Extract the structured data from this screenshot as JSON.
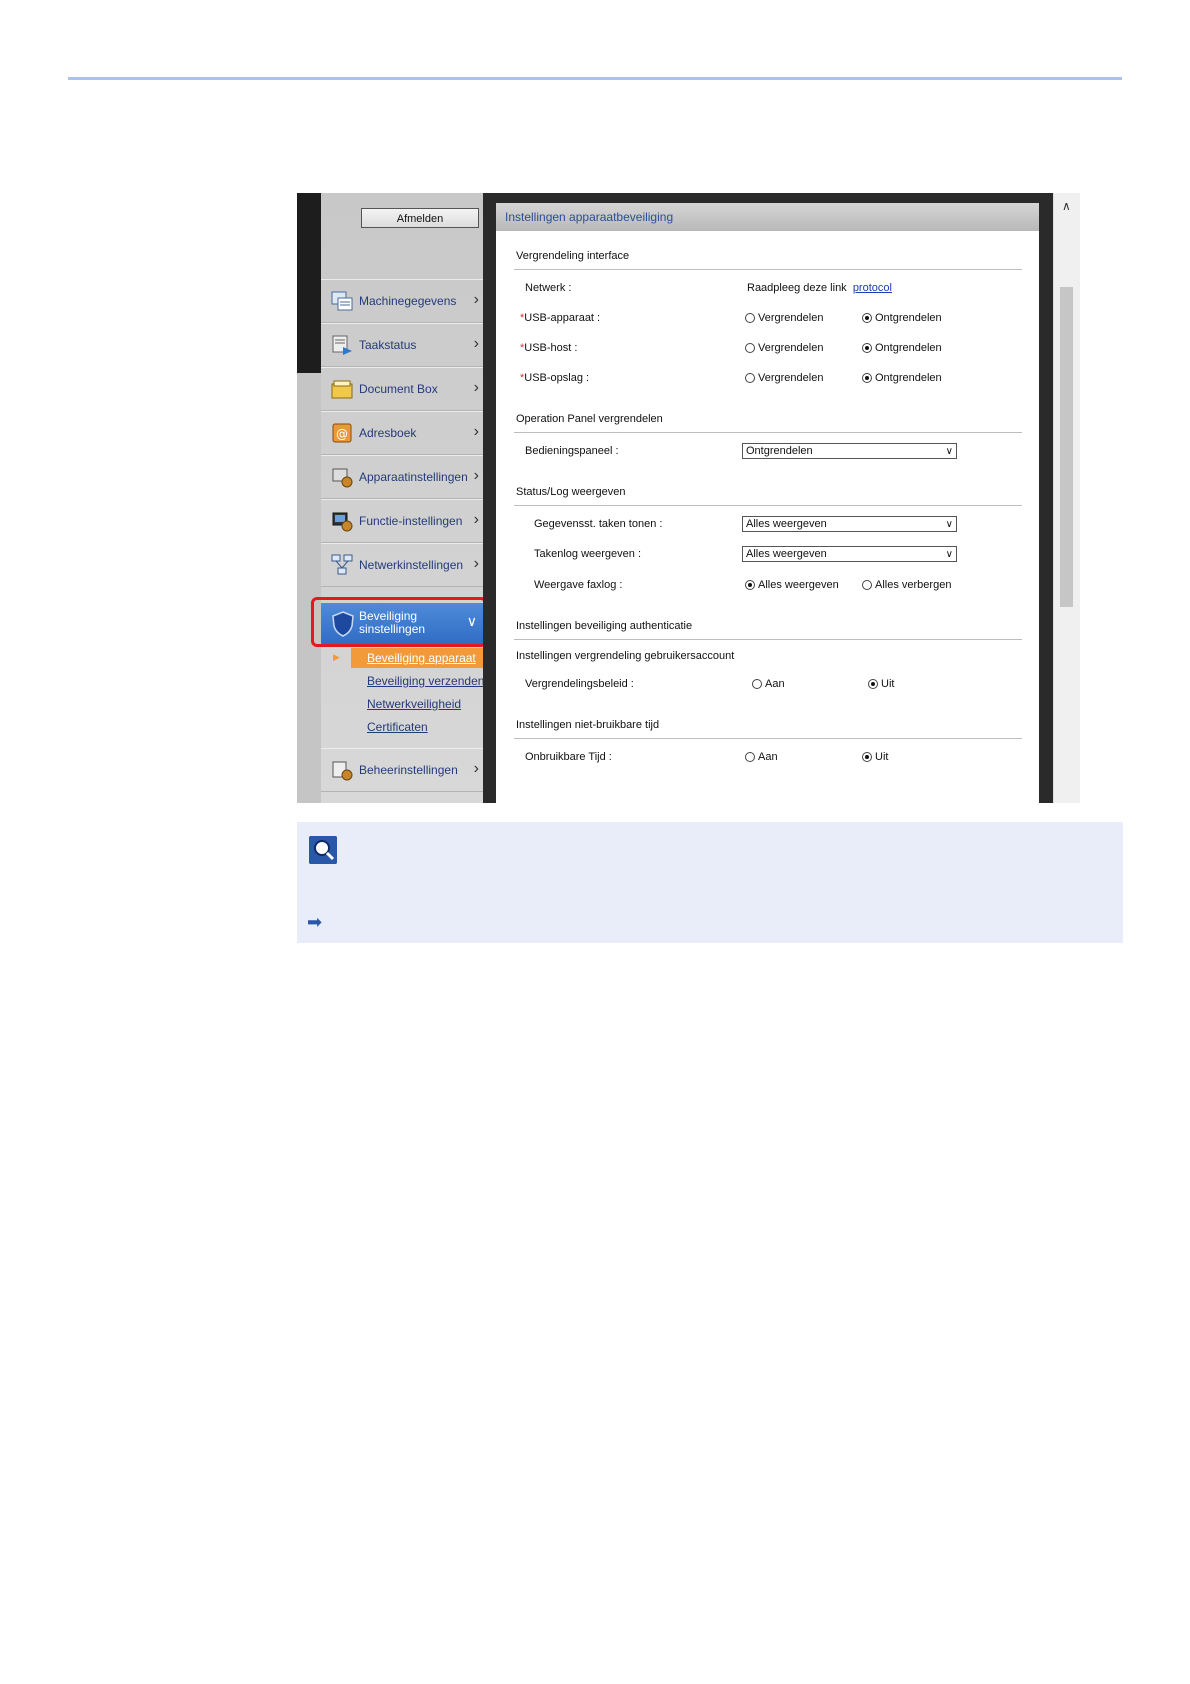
{
  "sidebar": {
    "logout_label": "Afmelden",
    "items": [
      {
        "label": "Machinegegevens",
        "icon": "machine-info-icon"
      },
      {
        "label": "Taakstatus",
        "icon": "job-status-icon"
      },
      {
        "label": "Document Box",
        "icon": "document-box-icon"
      },
      {
        "label": "Adresboek",
        "icon": "address-book-icon"
      },
      {
        "label": "Apparaatinstellingen",
        "icon": "device-settings-icon"
      },
      {
        "label": "Functie-instellingen",
        "icon": "function-settings-icon"
      },
      {
        "label": "Netwerkinstellingen",
        "icon": "network-settings-icon"
      }
    ],
    "selected": {
      "line1": "Beveiliging",
      "line2": "sinstellingen",
      "icon": "shield-icon"
    },
    "sub_items": [
      "Beveiliging apparaat",
      "Beveiliging verzenden",
      "Netwerkveiligheid",
      "Certificaten"
    ],
    "after_item": {
      "label": "Beheerinstellingen",
      "icon": "management-settings-icon"
    }
  },
  "panel": {
    "title": "Instellingen apparaatbeveiliging",
    "interface_lock": {
      "heading": "Vergrendeling interface",
      "network_label": "Netwerk :",
      "network_text": "Raadpleeg deze link",
      "network_link": "protocol",
      "rows": [
        {
          "label": "USB-apparaat :",
          "opt1": "Vergrendelen",
          "opt2": "Ontgrendelen"
        },
        {
          "label": "USB-host :",
          "opt1": "Vergrendelen",
          "opt2": "Ontgrendelen"
        },
        {
          "label": "USB-opslag :",
          "opt1": "Vergrendelen",
          "opt2": "Ontgrendelen"
        }
      ]
    },
    "panel_lock": {
      "heading": "Operation Panel vergrendelen",
      "label": "Bedieningspaneel :",
      "value": "Ontgrendelen"
    },
    "status_log": {
      "heading": "Status/Log weergeven",
      "row1_label": "Gegevensst. taken tonen :",
      "row1_value": "Alles weergeven",
      "row2_label": "Takenlog weergeven :",
      "row2_value": "Alles weergeven",
      "row3_label": "Weergave faxlog :",
      "row3_opt1": "Alles weergeven",
      "row3_opt2": "Alles verbergen"
    },
    "auth_security": {
      "heading": "Instellingen beveiliging authenticatie"
    },
    "account_lock": {
      "heading": "Instellingen vergrendeling gebruikersaccount",
      "label": "Vergrendelingsbeleid :",
      "opt1": "Aan",
      "opt2": "Uit"
    },
    "unusable_time": {
      "heading": "Instellingen niet-bruikbare tijd",
      "label": "Onbruikbare Tijd :",
      "opt1": "Aan",
      "opt2": "Uit"
    }
  },
  "colors": {
    "accent": "#2f6cc4",
    "highlight": "#e8161e",
    "active_sub": "#f29a3a",
    "note_bg": "#e8edf9"
  }
}
